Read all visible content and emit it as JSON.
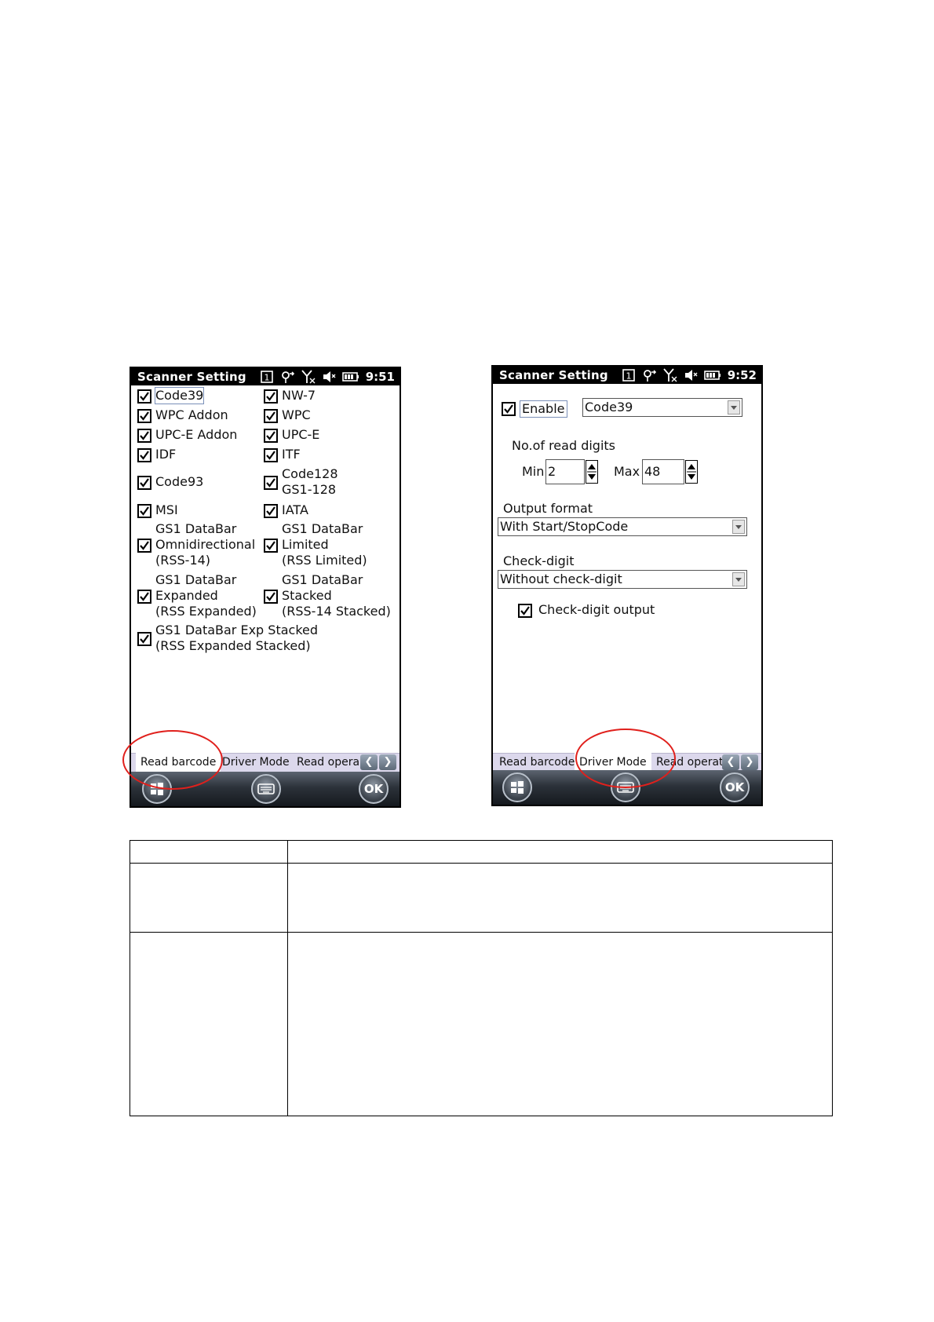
{
  "left_screen": {
    "title": "Scanner Setting",
    "clock": "9:51",
    "barcodes": [
      {
        "label": "Code39",
        "checked": true
      },
      {
        "label": "NW-7",
        "checked": true
      },
      {
        "label": "WPC Addon",
        "checked": true
      },
      {
        "label": "WPC",
        "checked": true
      },
      {
        "label": "UPC-E Addon",
        "checked": true
      },
      {
        "label": "UPC-E",
        "checked": true
      },
      {
        "label": "IDF",
        "checked": true
      },
      {
        "label": "ITF",
        "checked": true
      },
      {
        "label": "Code93",
        "checked": true
      },
      {
        "label": "Code128\nGS1-128",
        "checked": true
      },
      {
        "label": "MSI",
        "checked": true
      },
      {
        "label": "IATA",
        "checked": true
      },
      {
        "label": "GS1 DataBar\nOmnidirectional\n(RSS-14)",
        "checked": true
      },
      {
        "label": "GS1 DataBar\nLimited\n(RSS Limited)",
        "checked": true
      },
      {
        "label": "GS1 DataBar\nExpanded\n(RSS Expanded)",
        "checked": true
      },
      {
        "label": "GS1 DataBar\nStacked\n(RSS-14 Stacked)",
        "checked": true
      },
      {
        "label": "GS1 DataBar Exp Stacked\n(RSS Expanded Stacked)",
        "checked": true
      }
    ],
    "tabs": [
      "Read barcode",
      "Driver Mode",
      "Read opera"
    ],
    "active_tab": "Read barcode",
    "ok_label": "OK"
  },
  "right_screen": {
    "title": "Scanner Setting",
    "clock": "9:52",
    "enable_label": "Enable",
    "enable_checked": true,
    "symbology_value": "Code39",
    "read_digits_label": "No.of read digits",
    "min_label": "Min",
    "min_value": "2",
    "max_label": "Max",
    "max_value": "48",
    "output_format_label": "Output format",
    "output_format_value": "With Start/StopCode",
    "check_digit_label": "Check-digit",
    "check_digit_value": "Without check-digit",
    "check_digit_output_label": "Check-digit output",
    "check_digit_output_checked": true,
    "tabs": [
      "Read barcode",
      "Driver Mode",
      "Read operat"
    ],
    "active_tab": "Driver Mode",
    "ok_label": "OK"
  },
  "colors": {
    "highlight_circle": "#e0201c",
    "tabbar": "#dcd8ec",
    "titlebar": "#000000"
  }
}
